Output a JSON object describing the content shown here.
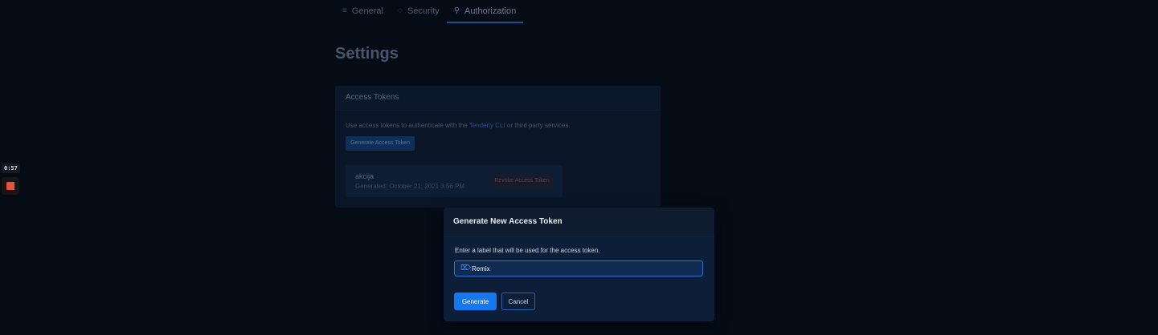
{
  "recorder": {
    "time": "0:57",
    "stop_icon": "stop-square-icon",
    "stop_color": "#e2553d"
  },
  "tabs": [
    {
      "label": "General",
      "icon": "sliders-icon",
      "glyph": "≡"
    },
    {
      "label": "Security",
      "icon": "shield-icon",
      "glyph": "◌"
    },
    {
      "label": "Authorization",
      "icon": "user-key-icon",
      "glyph": "⚲"
    }
  ],
  "page": {
    "title": "Settings"
  },
  "tokens": {
    "header": "Access Tokens",
    "desc_prefix": "Use access tokens to authenticate with the ",
    "desc_link": "Tenderly CLI",
    "desc_suffix": " or third party services.",
    "generate_button": "Generate Access Token",
    "items": [
      {
        "name": "akcija",
        "generated": "Generated: October 21, 2021 3:56 PM",
        "revoke_button": "Revoke Access Token"
      }
    ]
  },
  "modal": {
    "title": "Generate New Access Token",
    "description": "Enter a label that will be used for the access token.",
    "input_value": "Remix",
    "input_icon": "tag-icon",
    "generate_label": "Generate",
    "cancel_label": "Cancel",
    "accent": "#1677ee"
  }
}
